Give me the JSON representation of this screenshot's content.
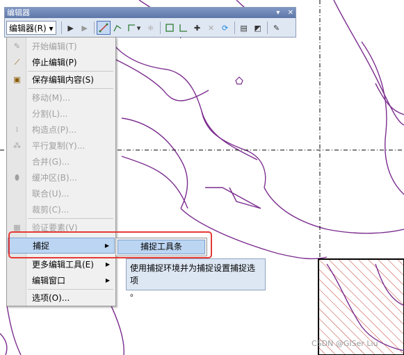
{
  "toolbar": {
    "title": "编辑器",
    "editor_menu_label": "编辑器(R)",
    "titlebar_buttons": [
      "▾",
      "✕"
    ]
  },
  "menu": {
    "items": [
      {
        "label": "开始编辑(T)",
        "enabled": false,
        "icon": "pencil-icon"
      },
      {
        "label": "停止编辑(P)",
        "enabled": true,
        "icon": "stop-edit-icon"
      },
      {
        "label": "保存编辑内容(S)",
        "enabled": true,
        "icon": "save-icon"
      },
      {
        "label": "移动(M)...",
        "enabled": false
      },
      {
        "label": "分割(L)...",
        "enabled": false
      },
      {
        "label": "构造点(P)...",
        "enabled": false,
        "icon": "construct-points-icon"
      },
      {
        "label": "平行复制(Y)...",
        "enabled": false,
        "icon": "copy-parallel-icon"
      },
      {
        "label": "合并(G)...",
        "enabled": false
      },
      {
        "label": "缓冲区(B)...",
        "enabled": false,
        "icon": "buffer-icon"
      },
      {
        "label": "联合(U)...",
        "enabled": false
      },
      {
        "label": "裁剪(C)...",
        "enabled": false
      },
      {
        "label": "验证要素(V)",
        "enabled": false,
        "icon": "validate-icon"
      },
      {
        "label": "捕捉",
        "enabled": true,
        "submenu": true
      },
      {
        "label": "更多编辑工具(E)",
        "enabled": true,
        "submenu": true
      },
      {
        "label": "编辑窗口",
        "enabled": true,
        "submenu": true
      },
      {
        "label": "选项(O)...",
        "enabled": true
      }
    ]
  },
  "submenu": {
    "item": "捕捉工具条"
  },
  "tooltip": {
    "line1": "使用捕捉环境并为捕捉设置捕捉选项",
    "line2": "。"
  },
  "watermark": "CSDN @GISer Liu",
  "colors": {
    "road": "#7b2d8e",
    "hatch": "#c0392b",
    "highlight": "#e53935",
    "accent": "#bcd5f2"
  }
}
